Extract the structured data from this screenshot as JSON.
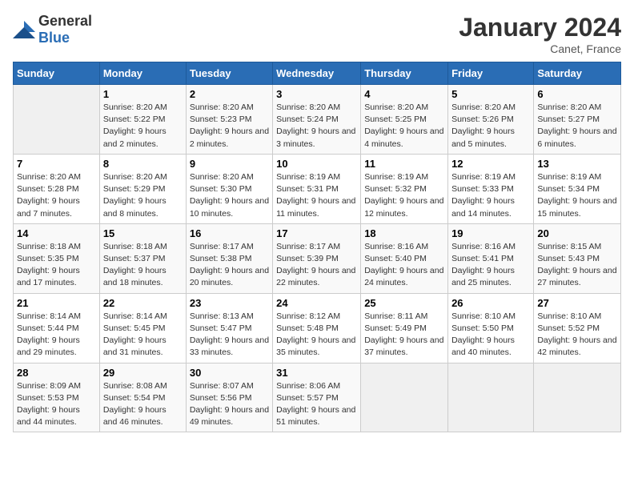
{
  "header": {
    "logo_general": "General",
    "logo_blue": "Blue",
    "title": "January 2024",
    "subtitle": "Canet, France"
  },
  "days_of_week": [
    "Sunday",
    "Monday",
    "Tuesday",
    "Wednesday",
    "Thursday",
    "Friday",
    "Saturday"
  ],
  "weeks": [
    [
      {
        "day": "",
        "sunrise": "",
        "sunset": "",
        "daylight": ""
      },
      {
        "day": "1",
        "sunrise": "8:20 AM",
        "sunset": "5:22 PM",
        "daylight": "9 hours and 2 minutes."
      },
      {
        "day": "2",
        "sunrise": "8:20 AM",
        "sunset": "5:23 PM",
        "daylight": "9 hours and 2 minutes."
      },
      {
        "day": "3",
        "sunrise": "8:20 AM",
        "sunset": "5:24 PM",
        "daylight": "9 hours and 3 minutes."
      },
      {
        "day": "4",
        "sunrise": "8:20 AM",
        "sunset": "5:25 PM",
        "daylight": "9 hours and 4 minutes."
      },
      {
        "day": "5",
        "sunrise": "8:20 AM",
        "sunset": "5:26 PM",
        "daylight": "9 hours and 5 minutes."
      },
      {
        "day": "6",
        "sunrise": "8:20 AM",
        "sunset": "5:27 PM",
        "daylight": "9 hours and 6 minutes."
      }
    ],
    [
      {
        "day": "7",
        "sunrise": "8:20 AM",
        "sunset": "5:28 PM",
        "daylight": "9 hours and 7 minutes."
      },
      {
        "day": "8",
        "sunrise": "8:20 AM",
        "sunset": "5:29 PM",
        "daylight": "9 hours and 8 minutes."
      },
      {
        "day": "9",
        "sunrise": "8:20 AM",
        "sunset": "5:30 PM",
        "daylight": "9 hours and 10 minutes."
      },
      {
        "day": "10",
        "sunrise": "8:19 AM",
        "sunset": "5:31 PM",
        "daylight": "9 hours and 11 minutes."
      },
      {
        "day": "11",
        "sunrise": "8:19 AM",
        "sunset": "5:32 PM",
        "daylight": "9 hours and 12 minutes."
      },
      {
        "day": "12",
        "sunrise": "8:19 AM",
        "sunset": "5:33 PM",
        "daylight": "9 hours and 14 minutes."
      },
      {
        "day": "13",
        "sunrise": "8:19 AM",
        "sunset": "5:34 PM",
        "daylight": "9 hours and 15 minutes."
      }
    ],
    [
      {
        "day": "14",
        "sunrise": "8:18 AM",
        "sunset": "5:35 PM",
        "daylight": "9 hours and 17 minutes."
      },
      {
        "day": "15",
        "sunrise": "8:18 AM",
        "sunset": "5:37 PM",
        "daylight": "9 hours and 18 minutes."
      },
      {
        "day": "16",
        "sunrise": "8:17 AM",
        "sunset": "5:38 PM",
        "daylight": "9 hours and 20 minutes."
      },
      {
        "day": "17",
        "sunrise": "8:17 AM",
        "sunset": "5:39 PM",
        "daylight": "9 hours and 22 minutes."
      },
      {
        "day": "18",
        "sunrise": "8:16 AM",
        "sunset": "5:40 PM",
        "daylight": "9 hours and 24 minutes."
      },
      {
        "day": "19",
        "sunrise": "8:16 AM",
        "sunset": "5:41 PM",
        "daylight": "9 hours and 25 minutes."
      },
      {
        "day": "20",
        "sunrise": "8:15 AM",
        "sunset": "5:43 PM",
        "daylight": "9 hours and 27 minutes."
      }
    ],
    [
      {
        "day": "21",
        "sunrise": "8:14 AM",
        "sunset": "5:44 PM",
        "daylight": "9 hours and 29 minutes."
      },
      {
        "day": "22",
        "sunrise": "8:14 AM",
        "sunset": "5:45 PM",
        "daylight": "9 hours and 31 minutes."
      },
      {
        "day": "23",
        "sunrise": "8:13 AM",
        "sunset": "5:47 PM",
        "daylight": "9 hours and 33 minutes."
      },
      {
        "day": "24",
        "sunrise": "8:12 AM",
        "sunset": "5:48 PM",
        "daylight": "9 hours and 35 minutes."
      },
      {
        "day": "25",
        "sunrise": "8:11 AM",
        "sunset": "5:49 PM",
        "daylight": "9 hours and 37 minutes."
      },
      {
        "day": "26",
        "sunrise": "8:10 AM",
        "sunset": "5:50 PM",
        "daylight": "9 hours and 40 minutes."
      },
      {
        "day": "27",
        "sunrise": "8:10 AM",
        "sunset": "5:52 PM",
        "daylight": "9 hours and 42 minutes."
      }
    ],
    [
      {
        "day": "28",
        "sunrise": "8:09 AM",
        "sunset": "5:53 PM",
        "daylight": "9 hours and 44 minutes."
      },
      {
        "day": "29",
        "sunrise": "8:08 AM",
        "sunset": "5:54 PM",
        "daylight": "9 hours and 46 minutes."
      },
      {
        "day": "30",
        "sunrise": "8:07 AM",
        "sunset": "5:56 PM",
        "daylight": "9 hours and 49 minutes."
      },
      {
        "day": "31",
        "sunrise": "8:06 AM",
        "sunset": "5:57 PM",
        "daylight": "9 hours and 51 minutes."
      },
      {
        "day": "",
        "sunrise": "",
        "sunset": "",
        "daylight": ""
      },
      {
        "day": "",
        "sunrise": "",
        "sunset": "",
        "daylight": ""
      },
      {
        "day": "",
        "sunrise": "",
        "sunset": "",
        "daylight": ""
      }
    ]
  ],
  "labels": {
    "sunrise": "Sunrise:",
    "sunset": "Sunset:",
    "daylight": "Daylight:"
  }
}
